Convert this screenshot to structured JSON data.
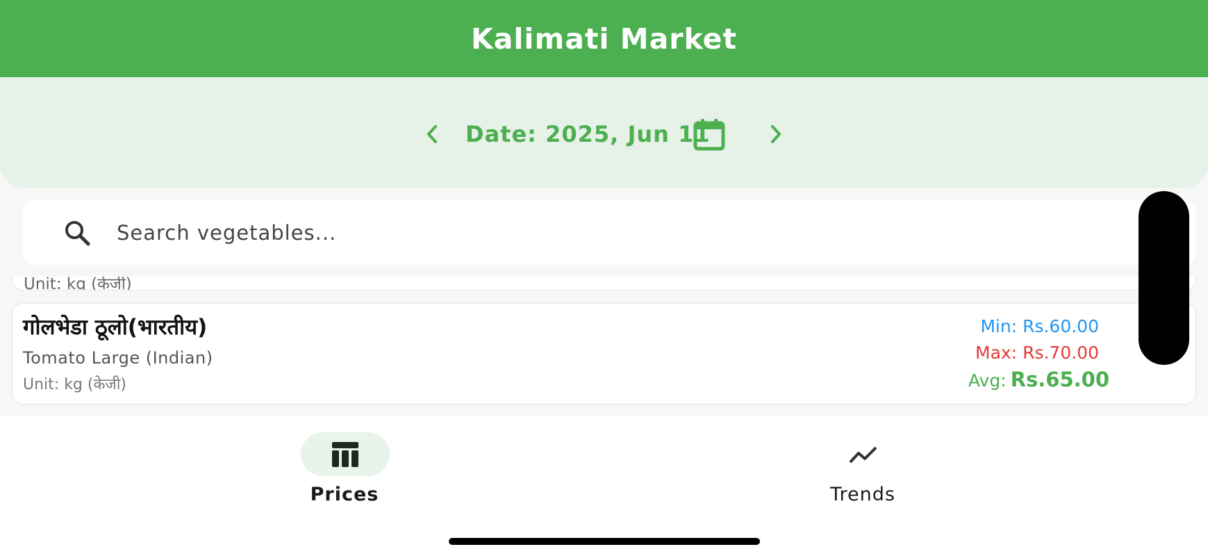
{
  "header": {
    "title": "Kalimati Market"
  },
  "date_bar": {
    "label": "Date: 2025, Jun 11",
    "prev_icon": "chevron-left-icon",
    "next_icon": "chevron-right-icon",
    "calendar_icon": "calendar-icon"
  },
  "search": {
    "placeholder": "Search vegetables...",
    "value": "",
    "icon": "search-icon"
  },
  "items": [
    {
      "name_np": "गोलभेडा ठूलो(भारतीय)",
      "name_en": "Tomato Large (Indian)",
      "unit": "Unit: kg (केजी)",
      "min": "Min: Rs.60.00",
      "max": "Max: Rs.70.00",
      "avg_label": "Avg:",
      "avg_value": "Rs.65.00"
    }
  ],
  "partial_item": {
    "unit_fragment": "Unit: kg (केजी)"
  },
  "bottom_nav": {
    "tabs": [
      {
        "label": "Prices",
        "icon": "table-icon",
        "selected": true
      },
      {
        "label": "Trends",
        "icon": "trending-icon",
        "selected": false
      }
    ]
  },
  "colors": {
    "primary": "#4caf50",
    "primary_light": "#e6f1e7",
    "min_price": "#2196f3",
    "max_price": "#e53935",
    "avg_price": "#4caf50"
  }
}
